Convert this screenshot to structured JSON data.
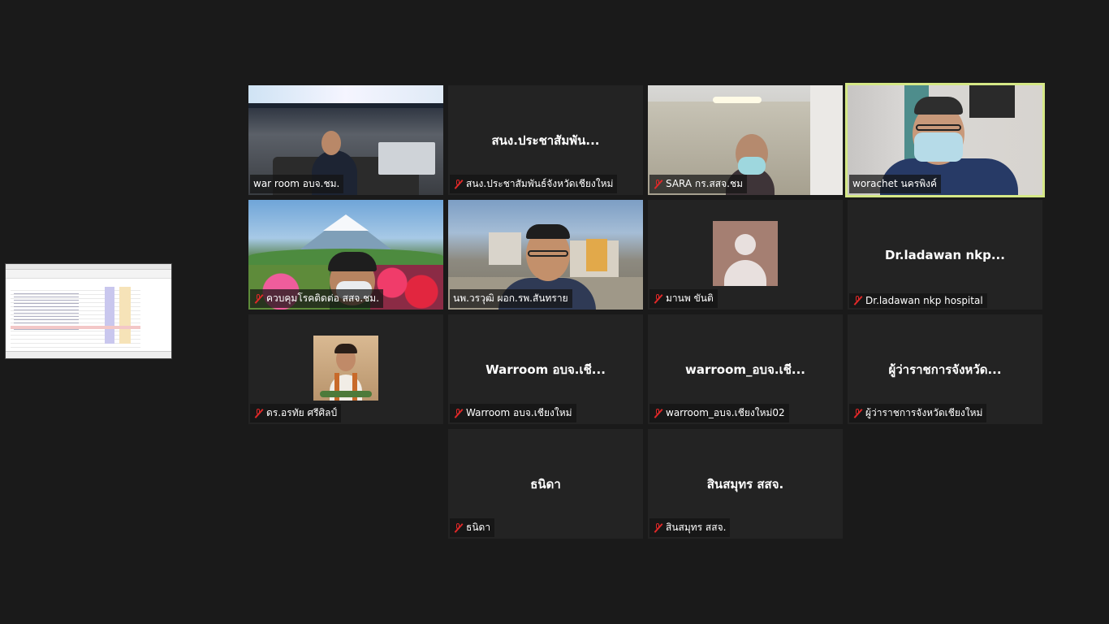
{
  "share": {
    "label": ""
  },
  "tiles": [
    {
      "id": "war-room",
      "label": "war room อบจ.ชม.",
      "muted": false,
      "video": true
    },
    {
      "id": "pr-chiangmai",
      "center": "สนง.ประชาสัมพัน...",
      "label": "สนง.ประชาสัมพันธ์จังหวัดเชียงใหม่",
      "muted": true
    },
    {
      "id": "sara",
      "label": "SARA กร.สสจ.ชม",
      "muted": true,
      "video": true
    },
    {
      "id": "worachet",
      "label": "worachet นครพิงค์",
      "muted": false,
      "video": true,
      "active": true
    },
    {
      "id": "disease-control",
      "label": "ควบคุมโรคติดต่อ สสจ.ชม.",
      "muted": true,
      "video": true
    },
    {
      "id": "sansai-hospital",
      "label": "นพ.วรวุฒิ ผอก.รพ.สันทราย",
      "muted": false,
      "video": true
    },
    {
      "id": "manop",
      "label": "มานพ ขันติ",
      "muted": true,
      "avatar": true
    },
    {
      "id": "ladawan",
      "center": "Dr.ladawan nkp...",
      "label": "Dr.ladawan nkp hospital",
      "muted": true
    },
    {
      "id": "orathai",
      "label": "ดร.อรทัย ศรีศิลป์",
      "muted": true,
      "photo": true
    },
    {
      "id": "warroom-1",
      "center": "Warroom อบจ.เชี...",
      "label": "Warroom อบจ.เชียงใหม่",
      "muted": true
    },
    {
      "id": "warroom-2",
      "center": "warroom_อบจ.เชี...",
      "label": "warroom_อบจ.เชียงใหม่02",
      "muted": true
    },
    {
      "id": "governor",
      "center": "ผู้ว่าราชการจังหวัด...",
      "label": "ผู้ว่าราชการจังหวัดเชียงใหม่",
      "muted": true
    },
    {
      "id": "thanida",
      "center": "ธนิดา",
      "label": "ธนิดา",
      "muted": true
    },
    {
      "id": "sinsamut",
      "center": "สินสมุทร สสจ.",
      "label": "สินสมุทร สสจ.",
      "muted": true
    }
  ],
  "colors": {
    "background": "#1a1a1a",
    "tile": "#232323",
    "active_border": "#d5e886",
    "muted_icon": "#e02828"
  }
}
